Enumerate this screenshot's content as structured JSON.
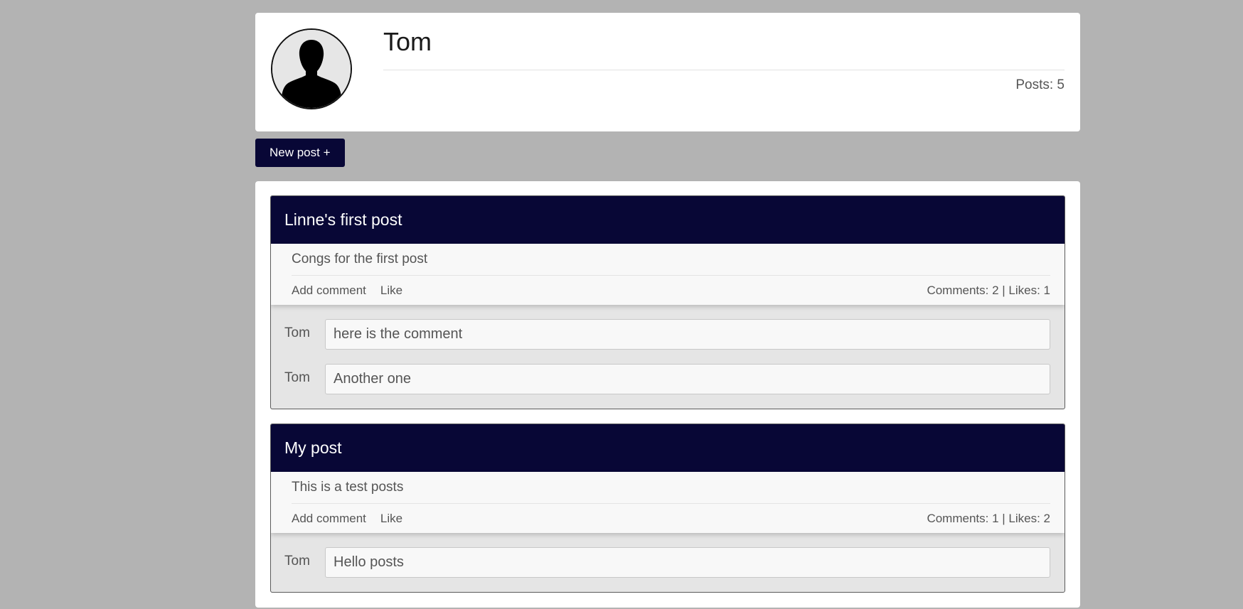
{
  "profile": {
    "name": "Tom",
    "posts_count": "Posts: 5"
  },
  "new_post_button": "New post +",
  "posts": [
    {
      "title": "Linne's first post",
      "text": "Congs for the first post",
      "add_comment": "Add comment",
      "like": "Like",
      "stats": "Comments: 2 | Likes: 1",
      "comments": [
        {
          "author": "Tom",
          "text": "here is the comment"
        },
        {
          "author": "Tom",
          "text": "Another one"
        }
      ]
    },
    {
      "title": "My post",
      "text": "This is a test posts",
      "add_comment": "Add comment",
      "like": "Like",
      "stats": "Comments: 1 | Likes: 2",
      "comments": [
        {
          "author": "Tom",
          "text": "Hello posts"
        }
      ]
    }
  ],
  "colors": {
    "background": "#b3b3b3",
    "accent": "#080736",
    "card": "#ffffff"
  }
}
